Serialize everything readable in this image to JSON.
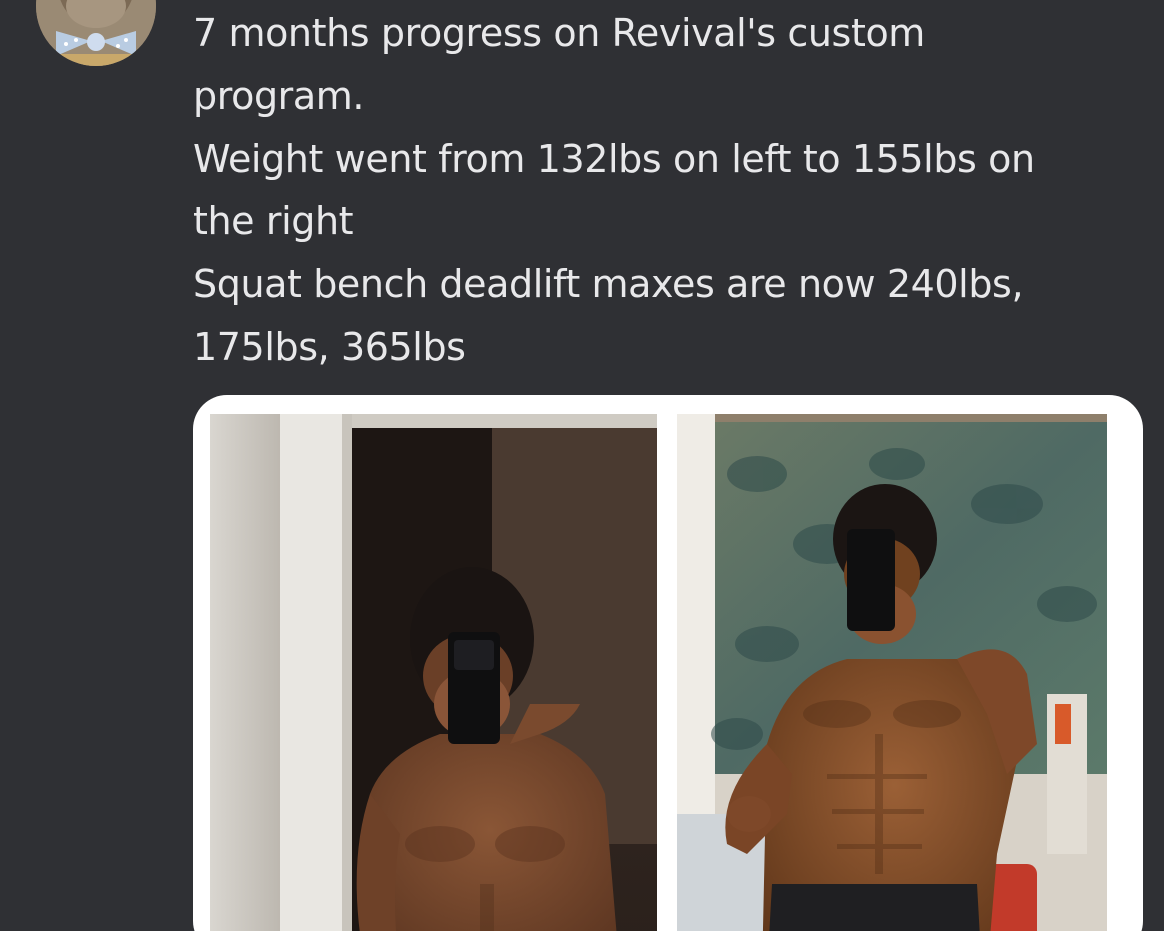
{
  "post": {
    "avatar_alt": "user avatar",
    "text_lines": [
      "7 months progress on Revival's custom",
      "program.",
      "Weight went from 132lbs on left to 155lbs on",
      "the right",
      "Squat bench deadlift maxes are now 240lbs,",
      "175lbs, 365lbs"
    ]
  },
  "media": {
    "photos": [
      {
        "label": "before photo"
      },
      {
        "label": "after photo"
      }
    ]
  },
  "colors": {
    "background": "#2f3034",
    "text": "#e8e8ea",
    "card": "#ffffff"
  }
}
